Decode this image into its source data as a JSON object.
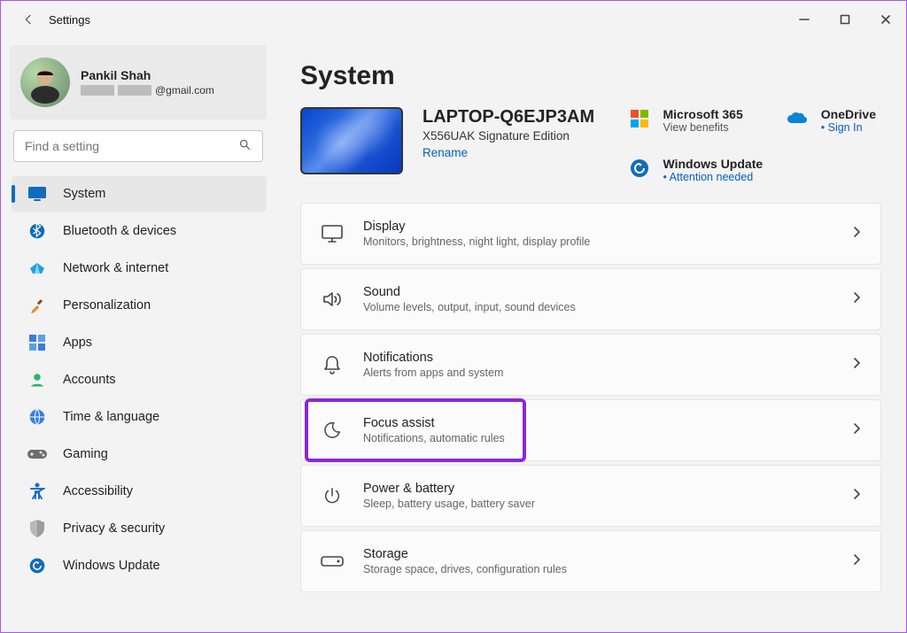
{
  "window": {
    "title": "Settings"
  },
  "profile": {
    "name": "Pankil Shah",
    "emailSuffix": "@gmail.com"
  },
  "search": {
    "placeholder": "Find a setting"
  },
  "nav": {
    "items": [
      {
        "id": "system",
        "label": "System",
        "active": true
      },
      {
        "id": "bluetooth",
        "label": "Bluetooth & devices"
      },
      {
        "id": "network",
        "label": "Network & internet"
      },
      {
        "id": "personalization",
        "label": "Personalization"
      },
      {
        "id": "apps",
        "label": "Apps"
      },
      {
        "id": "accounts",
        "label": "Accounts"
      },
      {
        "id": "time",
        "label": "Time & language"
      },
      {
        "id": "gaming",
        "label": "Gaming"
      },
      {
        "id": "accessibility",
        "label": "Accessibility"
      },
      {
        "id": "privacy",
        "label": "Privacy & security"
      },
      {
        "id": "update",
        "label": "Windows Update"
      }
    ]
  },
  "page": {
    "title": "System"
  },
  "device": {
    "name": "LAPTOP-Q6EJP3AM",
    "model": "X556UAK Signature Edition",
    "renameLabel": "Rename"
  },
  "heroRight": {
    "m365": {
      "title": "Microsoft 365",
      "sub": "View benefits"
    },
    "oneDrive": {
      "title": "OneDrive",
      "link": "Sign In"
    },
    "update": {
      "title": "Windows Update",
      "link": "Attention needed"
    }
  },
  "cards": [
    {
      "id": "display",
      "title": "Display",
      "sub": "Monitors, brightness, night light, display profile",
      "highlight": false
    },
    {
      "id": "sound",
      "title": "Sound",
      "sub": "Volume levels, output, input, sound devices",
      "highlight": false
    },
    {
      "id": "notifications",
      "title": "Notifications",
      "sub": "Alerts from apps and system",
      "highlight": false
    },
    {
      "id": "focus",
      "title": "Focus assist",
      "sub": "Notifications, automatic rules",
      "highlight": true
    },
    {
      "id": "power",
      "title": "Power & battery",
      "sub": "Sleep, battery usage, battery saver",
      "highlight": false
    },
    {
      "id": "storage",
      "title": "Storage",
      "sub": "Storage space, drives, configuration rules",
      "highlight": false
    }
  ]
}
